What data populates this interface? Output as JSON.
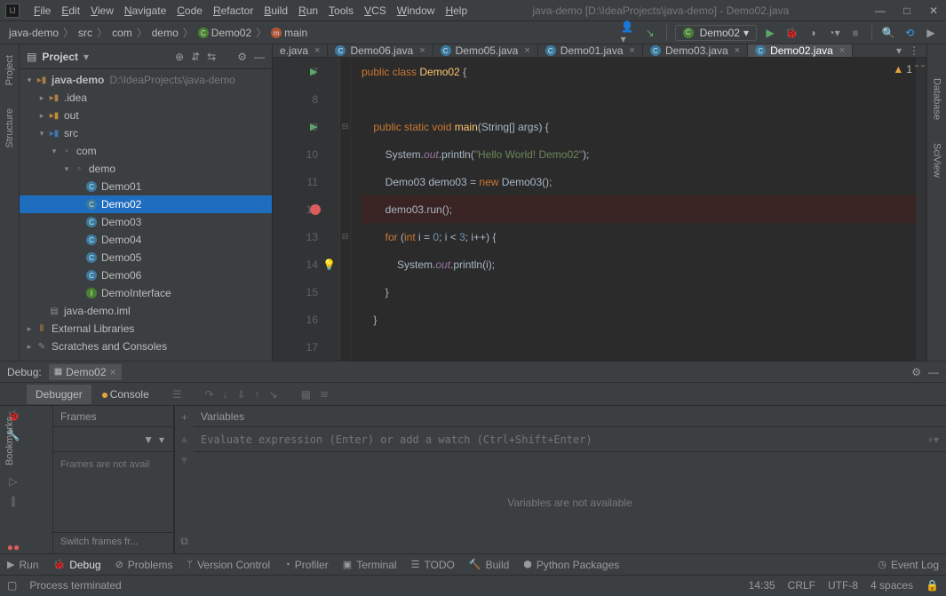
{
  "titlebar": {
    "menus": [
      "File",
      "Edit",
      "View",
      "Navigate",
      "Code",
      "Refactor",
      "Build",
      "Run",
      "Tools",
      "VCS",
      "Window",
      "Help"
    ],
    "path": "java-demo [D:\\IdeaProjects\\java-demo] - Demo02.java",
    "win": {
      "min": "—",
      "max": "□",
      "close": "✕"
    }
  },
  "breadcrumbs": [
    "java-demo",
    "src",
    "com",
    "demo",
    "Demo02",
    "main"
  ],
  "nav": {
    "run_config": "Demo02"
  },
  "left_rail": {
    "tabs": [
      "Project",
      "Structure"
    ]
  },
  "right_rail": {
    "tabs": [
      "Database",
      "SciView"
    ]
  },
  "project": {
    "title": "Project",
    "root": {
      "name": "java-demo",
      "path": "D:\\IdeaProjects\\java-demo"
    },
    "idea": ".idea",
    "out": "out",
    "src": "src",
    "com": "com",
    "demo": "demo",
    "classes": [
      "Demo01",
      "Demo02",
      "Demo03",
      "Demo04",
      "Demo05",
      "Demo06"
    ],
    "iface": "DemoInterface",
    "iml": "java-demo.iml",
    "ext": "External Libraries",
    "scratch": "Scratches and Consoles"
  },
  "editor": {
    "tabs": [
      {
        "name": "e.java",
        "short": true
      },
      {
        "name": "Demo06.java"
      },
      {
        "name": "Demo05.java"
      },
      {
        "name": "Demo01.java"
      },
      {
        "name": "Demo03.java"
      },
      {
        "name": "Demo02.java",
        "active": true
      }
    ],
    "warn_count": "1",
    "lines": [
      {
        "n": "7",
        "run": true,
        "code": [
          [
            "kw",
            "public class "
          ],
          [
            "fn",
            "Demo02 "
          ],
          [
            "",
            "{ "
          ]
        ]
      },
      {
        "n": "8",
        "code": []
      },
      {
        "n": "9",
        "run": true,
        "fold": "⊟",
        "code": [
          [
            "",
            "    "
          ],
          [
            "kw",
            "public static void "
          ],
          [
            "fn",
            "main"
          ],
          [
            "",
            "("
          ],
          [
            "",
            "String[] args) {"
          ]
        ]
      },
      {
        "n": "10",
        "code": [
          [
            "",
            "        System."
          ],
          [
            "fld",
            "out"
          ],
          [
            "",
            ".println("
          ],
          [
            "str",
            "\"Hello World! Demo02\""
          ],
          [
            "",
            ");"
          ]
        ]
      },
      {
        "n": "11",
        "code": [
          [
            "",
            "        Demo03 demo03 = "
          ],
          [
            "kw",
            "new "
          ],
          [
            "",
            "Demo03();"
          ]
        ]
      },
      {
        "n": "12",
        "bp": true,
        "hl": true,
        "code": [
          [
            "",
            "        demo03.run();"
          ]
        ]
      },
      {
        "n": "13",
        "fold": "⊟",
        "code": [
          [
            "",
            "        "
          ],
          [
            "kw",
            "for "
          ],
          [
            "",
            "("
          ],
          [
            "kw",
            "int "
          ],
          [
            "",
            "i = "
          ],
          [
            "num",
            "0"
          ],
          [
            "",
            "; i < "
          ],
          [
            "num",
            "3"
          ],
          [
            "",
            "; i++) {"
          ]
        ]
      },
      {
        "n": "14",
        "bulb": true,
        "code": [
          [
            "",
            "            System."
          ],
          [
            "fld",
            "out"
          ],
          [
            "",
            ".println(i);"
          ]
        ]
      },
      {
        "n": "15",
        "code": [
          [
            "",
            "        }"
          ]
        ]
      },
      {
        "n": "16",
        "code": [
          [
            "",
            "    }"
          ]
        ]
      },
      {
        "n": "17",
        "code": []
      }
    ]
  },
  "debug": {
    "title": "Debug:",
    "config": "Demo02",
    "tabs": {
      "debugger": "Debugger",
      "console": "Console"
    },
    "frames": {
      "title": "Frames",
      "empty": "Frames are not avail",
      "foot": "Switch frames fr..."
    },
    "vars": {
      "title": "Variables",
      "placeholder": "Evaluate expression (Enter) or add a watch (Ctrl+Shift+Enter)",
      "empty": "Variables are not available"
    }
  },
  "bottom": {
    "run": "Run",
    "debug": "Debug",
    "problems": "Problems",
    "vcs": "Version Control",
    "profiler": "Profiler",
    "terminal": "Terminal",
    "todo": "TODO",
    "build": "Build",
    "pypkg": "Python Packages",
    "eventlog": "Event Log"
  },
  "status": {
    "msg": "Process terminated",
    "time": "14:35",
    "eol": "CRLF",
    "enc": "UTF-8",
    "indent": "4 spaces"
  }
}
